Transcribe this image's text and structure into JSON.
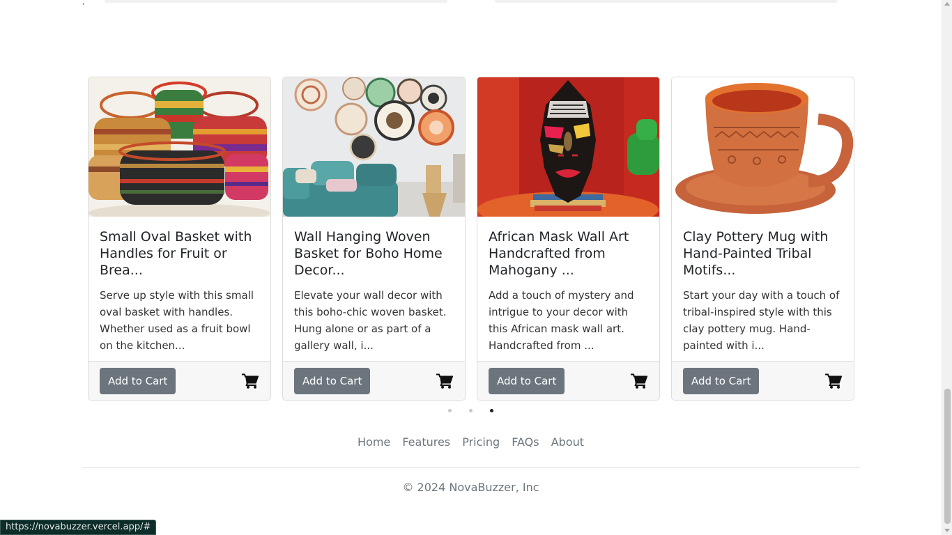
{
  "top_mark": ",",
  "products": [
    {
      "title": "Small Oval Basket with Handles for Fruit or Brea...",
      "description": "Serve up style with this small oval basket with handles. Whether used as a fruit bowl on the kitchen...",
      "button_label": "Add to Cart",
      "icon": "cart-icon"
    },
    {
      "title": "Wall Hanging Woven Basket for Boho Home Decor...",
      "description": "Elevate your wall decor with this boho-chic woven basket. Hung alone or as part of a gallery wall, i...",
      "button_label": "Add to Cart",
      "icon": "cart-icon"
    },
    {
      "title": "African Mask Wall Art Handcrafted from Mahogany ...",
      "description": "Add a touch of mystery and intrigue to your decor with this African mask wall art. Handcrafted from ...",
      "button_label": "Add to Cart",
      "icon": "cart-icon"
    },
    {
      "title": "Clay Pottery Mug with Hand-Painted Tribal Motifs...",
      "description": "Start your day with a touch of tribal-inspired style with this clay pottery mug. Hand-painted with i...",
      "button_label": "Add to Cart",
      "icon": "cart-icon"
    }
  ],
  "carousel": {
    "slide_count": 3,
    "active_index": 2
  },
  "footer": {
    "links": [
      "Home",
      "Features",
      "Pricing",
      "FAQs",
      "About"
    ],
    "copyright": "© 2024 NovaBuzzer, Inc"
  },
  "status_bar": {
    "url": "https://novabuzzer.vercel.app/#"
  },
  "colors": {
    "button": "#6c757d",
    "link": "#6c757d",
    "active_dot": "#222222",
    "inactive_dot": "#c8c8c8"
  }
}
